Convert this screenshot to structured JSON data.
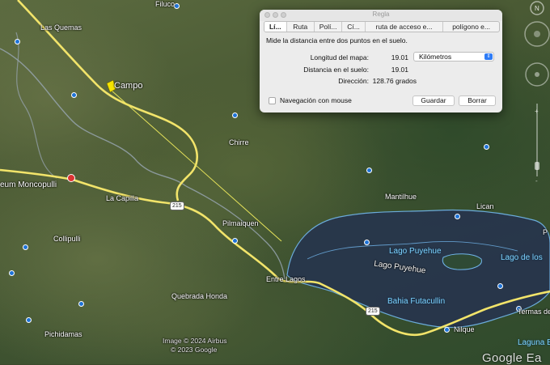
{
  "dialog": {
    "title": "Regla",
    "tabs": [
      {
        "label": "Lí...",
        "active": true
      },
      {
        "label": "Ruta",
        "active": false
      },
      {
        "label": "Polí...",
        "active": false
      },
      {
        "label": "Cí...",
        "active": false
      },
      {
        "label": "ruta de acceso e...",
        "active": false
      },
      {
        "label": "polígono e...",
        "active": false
      }
    ],
    "description": "Mide la distancia entre dos puntos en el suelo.",
    "map_length_label": "Longitud del mapa:",
    "map_length_value": "19.01",
    "unit_selected": "Kilómetros",
    "ground_length_label": "Distancia en el suelo:",
    "ground_length_value": "19.01",
    "direction_label": "Dirección:",
    "direction_value": "128.76 grados",
    "mouse_nav_label": "Navegación con mouse",
    "mouse_nav_checked": false,
    "save_label": "Guardar",
    "clear_label": "Borrar"
  },
  "map": {
    "places": {
      "filuco": "Filuco",
      "las_quemas": "Las Quemas",
      "campo": "Campo",
      "chirre": "Chirre",
      "moncopulli": "eum Moncopulli",
      "la_capilla": "La Capilla",
      "collipulli": "Collipulli",
      "pilmaiquen": "Pilmaiquen",
      "mantilhue": "Mantilhue",
      "lican": "Lican",
      "lago_puyehue_1": "Lago Puyehue",
      "lago_puyehue_2": "Lago Puyehue",
      "lago_de_los": "Lago de los",
      "entre_lagos": "Entre Lagos",
      "bahia": "Bahia Futacullin",
      "quebrada": "Quebrada Honda",
      "pichidamas": "Pichidamas",
      "nilque": "Nilque",
      "termas": "Termas de",
      "laguna": "Laguna B",
      "p_edge": "P"
    },
    "route_shield_1": "215",
    "route_shield_2": "215",
    "credit_1": "Image © 2024 Airbus",
    "credit_2": "© 2023 Google",
    "logo": "Google Ea"
  },
  "colors": {
    "road": "#f2e46a",
    "ruler": "#e8e45a",
    "lake": "#2b3a55",
    "lake_outline": "#6fb3e8"
  }
}
